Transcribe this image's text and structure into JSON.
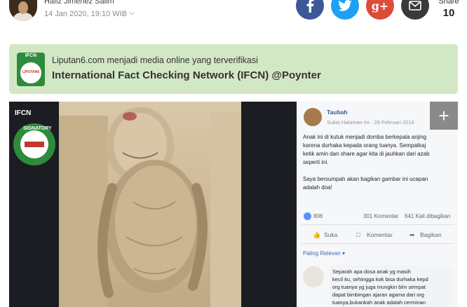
{
  "author": {
    "name": "Hafiz Jimenez Salim",
    "date": "14 Jan 2020, 19:10 WIB"
  },
  "share": {
    "label": "Share",
    "count": "10",
    "buttons": [
      "facebook-icon",
      "twitter-icon",
      "google-plus-icon",
      "email-icon"
    ]
  },
  "banner": {
    "badge_top": "IFCN",
    "badge_inner": "LIPUTAN6",
    "line1": "Liputan6.com menjadi media online yang terverifikasi",
    "line2": "International Fact Checking Network (IFCN) @Poynter",
    "bg_color": "#d2e8c4"
  },
  "photo": {
    "overlay_logo": "IFCN",
    "overlay_word": "SIGNATORY"
  },
  "facebook_post": {
    "page_name": "Taubah",
    "subline": "Sukai Halaman Ini · 28 Februari 2018 ·",
    "text_lines": [
      "Anak ini di kutuk menjadi domba berkepala anjing",
      "karena durhaka kepada orang tuanya. Sempatkaj",
      "ketik amin dan share agar kita di jauhkan dari azab",
      "seperti ini."
    ],
    "text_lines2": [
      "Saya bersumpah akan bagikan gambar ini ucapan",
      "adalah doa!"
    ],
    "reactions": "806",
    "comments": "301 Komentar",
    "shares": "641 Kali dibagikan",
    "actions": [
      "Suka",
      "Komentar",
      "Bagikan"
    ],
    "sort_label": "Paling Relevan ▾",
    "comment_lines": [
      "Separah apa dosa anak yg masih",
      "kecil itu, sehingga kok bisa durhaka kepd",
      "org tuanya yg juga mungkin blm sempat",
      "dapat bimbingan ajaran agama dari org",
      "tuanya,bukankah anak adalah cerminan"
    ]
  }
}
